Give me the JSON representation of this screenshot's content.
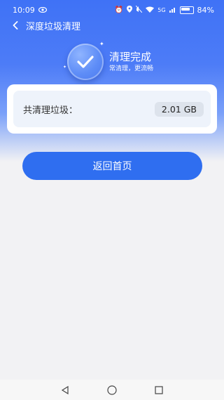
{
  "status_bar": {
    "time": "10:09",
    "battery": "84%",
    "network": "5G"
  },
  "header": {
    "title": "深度垃圾清理"
  },
  "hero": {
    "title": "清理完成",
    "subtitle": "常清理，更流畅"
  },
  "result": {
    "label": "共清理垃圾：",
    "value": "2.01 GB"
  },
  "actions": {
    "home_label": "返回首页"
  },
  "colors": {
    "primary": "#2f6ef0",
    "header_bg": "#3f72f6"
  }
}
